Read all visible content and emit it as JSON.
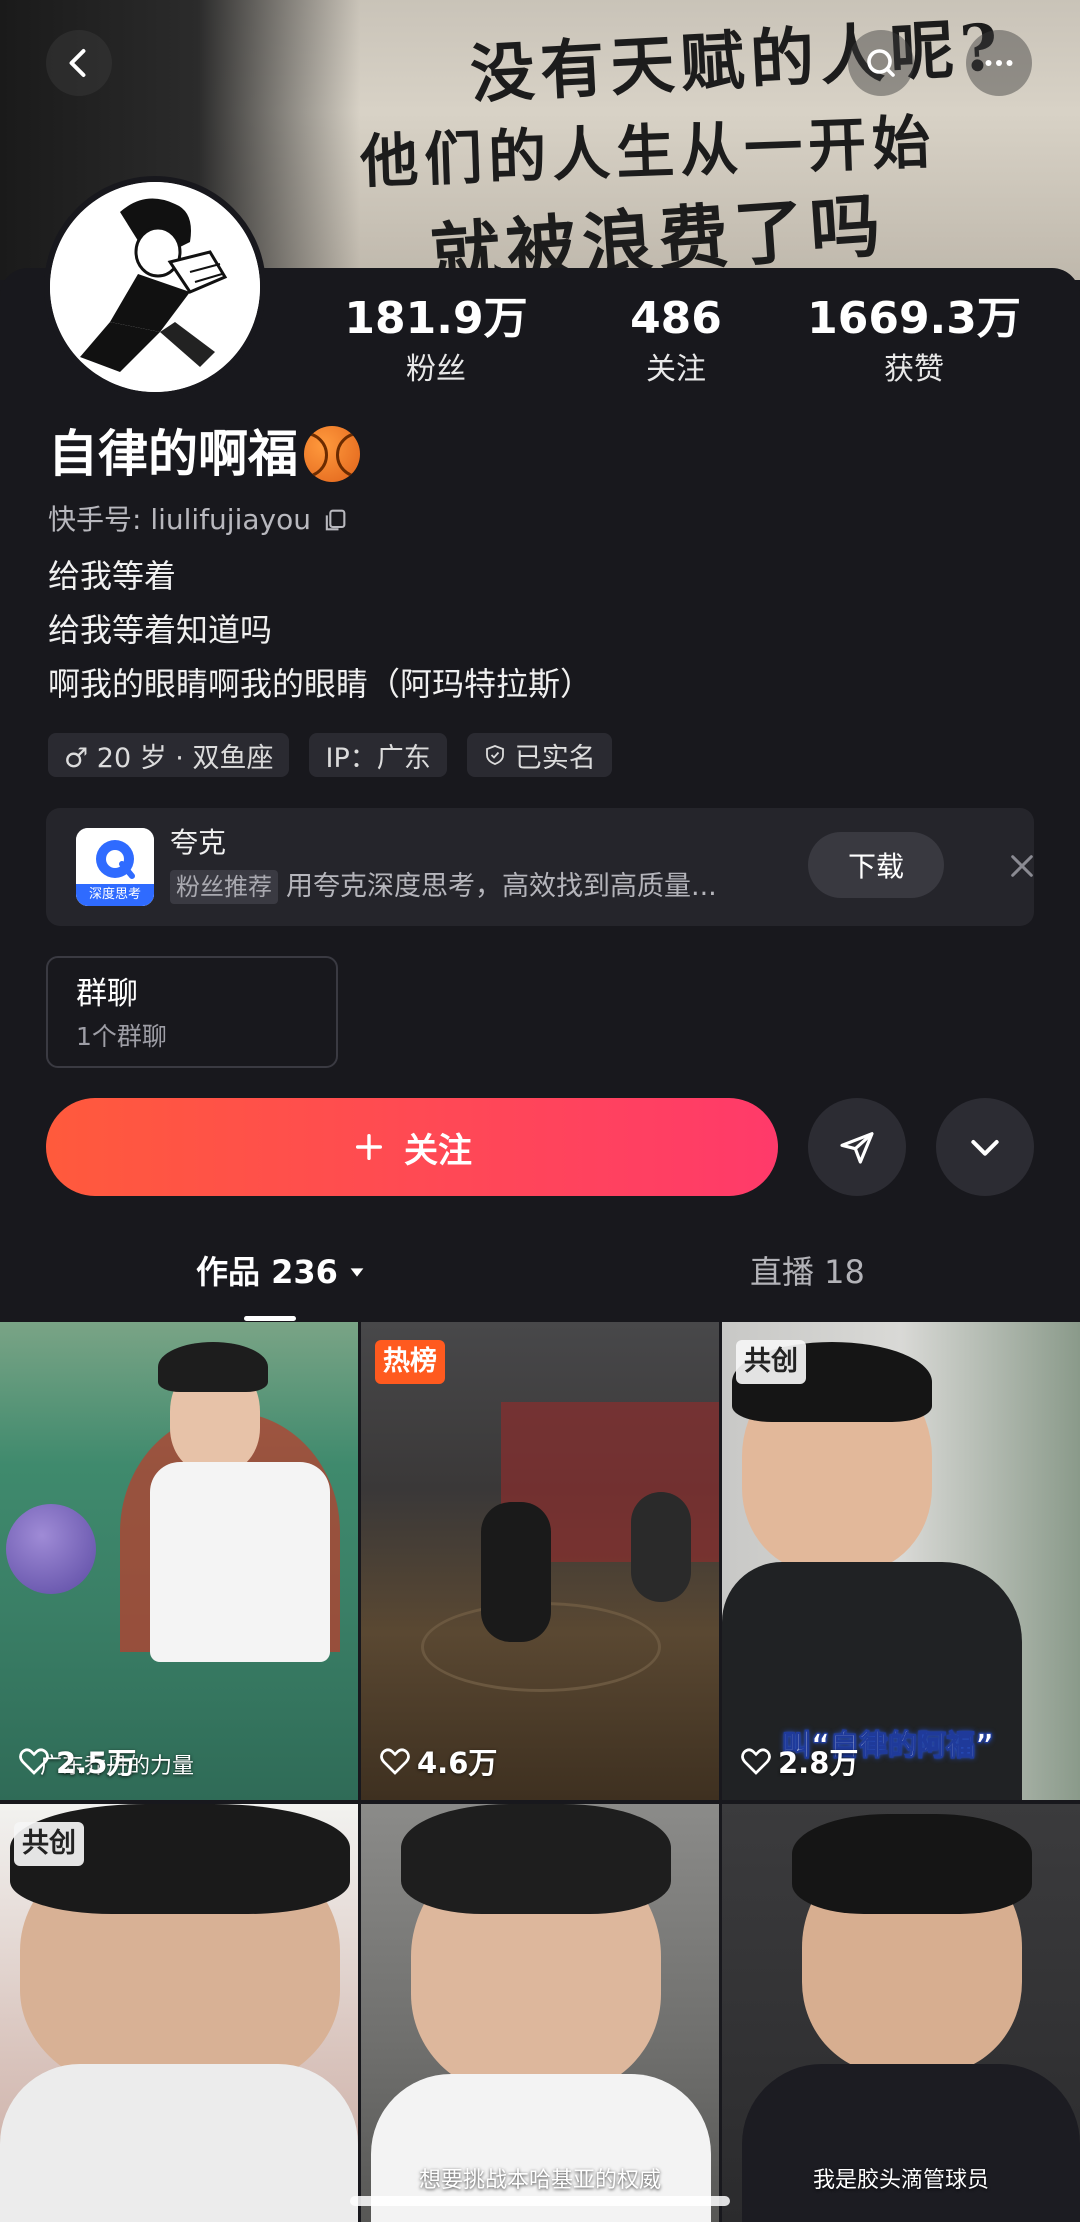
{
  "banner": {
    "graffiti_lines": [
      "没有天赋的人呢?",
      "他们的人生从一开始",
      "就被浪费了吗"
    ]
  },
  "header": {
    "back_icon": "chevron-left-icon",
    "search_icon": "search-icon",
    "more_icon": "more-icon"
  },
  "profile": {
    "name": "自律的啊福",
    "name_emoji": "basketball-icon",
    "uid_label": "快手号: liulifujiayou",
    "stats": [
      {
        "num": "181.9万",
        "label": "粉丝"
      },
      {
        "num": "486",
        "label": "关注"
      },
      {
        "num": "1669.3万",
        "label": "获赞"
      }
    ],
    "bio": [
      "给我等着",
      "给我等着知道吗",
      "啊我的眼睛啊我的眼睛（阿玛特拉斯）"
    ],
    "tags": [
      "♂ 20 岁 · 双鱼座",
      "IP：广东",
      "已实名"
    ]
  },
  "ad": {
    "logo_text": "深度思考",
    "title": "夸克",
    "badge": "粉丝推荐",
    "desc": "用夸克深度思考，高效找到高质量...",
    "button": "下载"
  },
  "group": {
    "title": "群聊",
    "subtitle": "1个群聊"
  },
  "actions": {
    "follow": "关注",
    "follow_color_start": "#ff5a3c",
    "follow_color_end": "#ff3a6a"
  },
  "tabs": {
    "works": "作品 236",
    "live": "直播 18"
  },
  "videos": [
    {
      "badge": "",
      "likes": "2.5万",
      "caption": "广东乔丹的力量"
    },
    {
      "badge": "热榜",
      "likes": "4.6万",
      "caption": ""
    },
    {
      "badge": "共创",
      "likes": "2.8万",
      "caption": "叫“自律的阿福”"
    },
    {
      "badge": "共创",
      "likes": "",
      "caption": ""
    },
    {
      "badge": "",
      "likes": "",
      "caption": "想要挑战本哈基亚的权威"
    },
    {
      "badge": "",
      "likes": "",
      "caption": "我是胶头滴管球员"
    }
  ]
}
